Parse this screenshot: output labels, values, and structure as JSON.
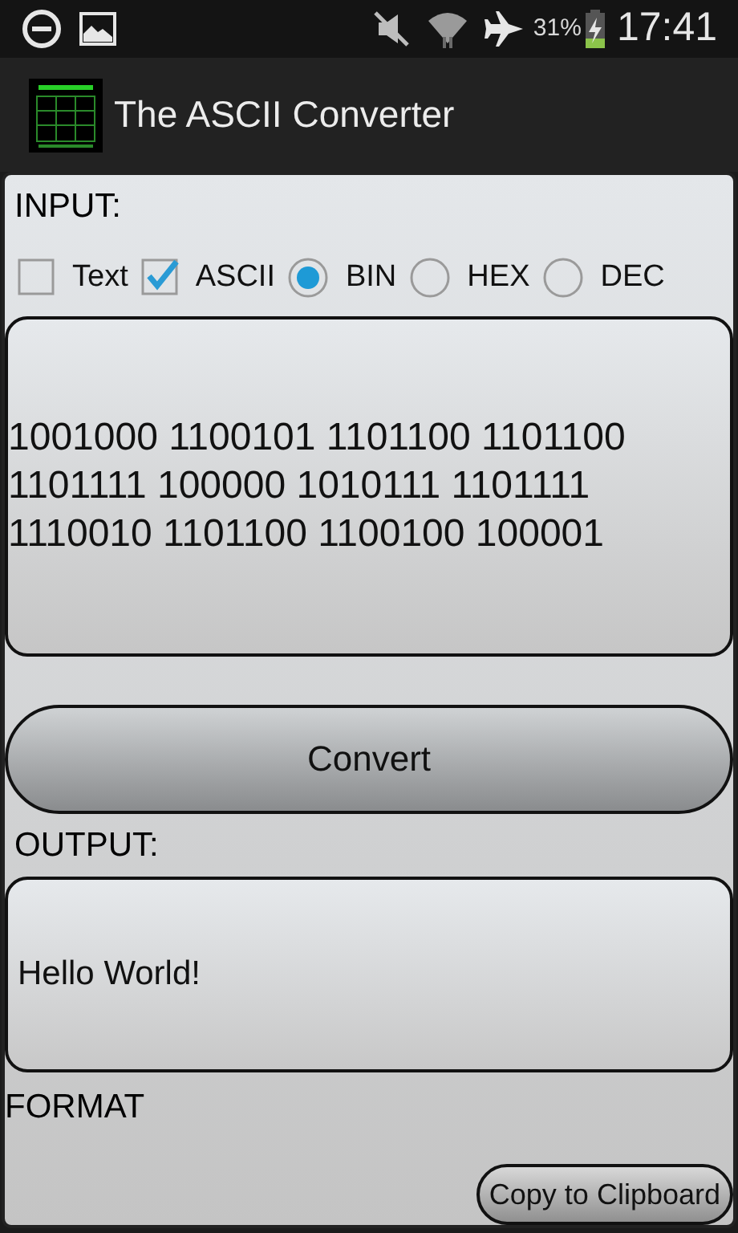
{
  "status_bar": {
    "battery": "31%",
    "time": "17:41"
  },
  "app_bar": {
    "title": "The ASCII Converter"
  },
  "input": {
    "label": "INPUT:",
    "value": "1001000 1100101 1101100 1101100 1101111 100000 1010111 1101111 1110010 1101100 1100100 100001"
  },
  "options": [
    {
      "kind": "checkbox",
      "label": "Text",
      "checked": false
    },
    {
      "kind": "checkbox",
      "label": "ASCII",
      "checked": true
    },
    {
      "kind": "radio",
      "label": "BIN",
      "selected": true
    },
    {
      "kind": "radio",
      "label": "HEX",
      "selected": false
    },
    {
      "kind": "radio",
      "label": "DEC",
      "selected": false
    }
  ],
  "convert_button": "Convert",
  "output": {
    "label": "OUTPUT:",
    "value": "Hello World!"
  },
  "format_label": "FORMAT",
  "copy_button": "Copy to Clipboard"
}
